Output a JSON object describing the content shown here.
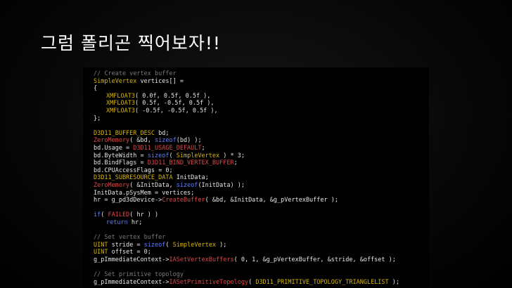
{
  "slide": {
    "title": "그럼 폴리곤 찍어보자!!"
  },
  "colors": {
    "background": "#000000",
    "title": "#ffffff",
    "code_text": "#e6e6e6",
    "comment": "#7a7a7a",
    "keyword": "#5f7dff",
    "type": "#d7b60c",
    "function": "#e04848"
  },
  "code": {
    "lines": [
      [
        [
          "c",
          "// Create vertex buffer"
        ]
      ],
      [
        [
          "ty",
          "SimpleVertex"
        ],
        [
          "tx",
          " vertices[] ="
        ]
      ],
      [
        [
          "tx",
          "{"
        ]
      ],
      [
        [
          "ty",
          "XMFLOAT3"
        ],
        [
          "tx",
          "( 0.0f, 0.5f, 0.5f ),"
        ]
      ],
      [
        [
          "ty",
          "XMFLOAT3"
        ],
        [
          "tx",
          "( 0.5f, -0.5f, 0.5f ),"
        ]
      ],
      [
        [
          "ty",
          "XMFLOAT3"
        ],
        [
          "tx",
          "( -0.5f, -0.5f, 0.5f ),"
        ]
      ],
      [
        [
          "tx",
          "};"
        ]
      ],
      [],
      [
        [
          "ty",
          "D3D11_BUFFER_DESC"
        ],
        [
          "tx",
          " bd;"
        ]
      ],
      [
        [
          "fn",
          "ZeroMemory"
        ],
        [
          "tx",
          "( &bd, "
        ],
        [
          "kw",
          "sizeof"
        ],
        [
          "tx",
          "(bd) );"
        ]
      ],
      [
        [
          "tx",
          "bd.Usage = "
        ],
        [
          "fn",
          "D3D11_USAGE_DEFAULT"
        ],
        [
          "tx",
          ";"
        ]
      ],
      [
        [
          "tx",
          "bd.ByteWidth = "
        ],
        [
          "kw",
          "sizeof"
        ],
        [
          "tx",
          "( "
        ],
        [
          "ty",
          "SimpleVertex"
        ],
        [
          "tx",
          " ) * 3;"
        ]
      ],
      [
        [
          "tx",
          "bd.BindFlags = "
        ],
        [
          "fn",
          "D3D11_BIND_VERTEX_BUFFER"
        ],
        [
          "tx",
          ";"
        ]
      ],
      [
        [
          "tx",
          "bd.CPUAccessFlags = 0;"
        ]
      ],
      [
        [
          "ty",
          "D3D11_SUBRESOURCE_DATA"
        ],
        [
          "tx",
          " InitData;"
        ]
      ],
      [
        [
          "fn",
          "ZeroMemory"
        ],
        [
          "tx",
          "( &InitData, "
        ],
        [
          "kw",
          "sizeof"
        ],
        [
          "tx",
          "(InitData) );"
        ]
      ],
      [
        [
          "tx",
          "InitData.pSysMem = vertices;"
        ]
      ],
      [
        [
          "tx",
          "hr = g_pd3dDevice->"
        ],
        [
          "fn",
          "CreateBuffer"
        ],
        [
          "tx",
          "( &bd, &InitData, &g_pVertexBuffer );"
        ]
      ],
      [],
      [
        [
          "kw",
          "if"
        ],
        [
          "tx",
          "( "
        ],
        [
          "fn",
          "FAILED"
        ],
        [
          "tx",
          "( hr ) )"
        ]
      ],
      [
        [
          "kw",
          "return"
        ],
        [
          "tx",
          " hr;"
        ]
      ],
      [],
      [
        [
          "c",
          "// Set vertex buffer"
        ]
      ],
      [
        [
          "ty",
          "UINT"
        ],
        [
          "tx",
          " stride = "
        ],
        [
          "kw",
          "sizeof"
        ],
        [
          "tx",
          "( "
        ],
        [
          "ty",
          "SimpleVertex"
        ],
        [
          "tx",
          " );"
        ]
      ],
      [
        [
          "ty",
          "UINT"
        ],
        [
          "tx",
          " offset = 0;"
        ]
      ],
      [
        [
          "tx",
          "g_pImmediateContext->"
        ],
        [
          "fn",
          "IASetVertexBuffers"
        ],
        [
          "tx",
          "( 0, 1, &g_pVertexBuffer, &stride, &offset );"
        ]
      ],
      [],
      [
        [
          "c",
          "// Set primitive topology"
        ]
      ],
      [
        [
          "tx",
          "g_pImmediateContext->"
        ],
        [
          "fn",
          "IASetPrimitiveTopology"
        ],
        [
          "tx",
          "( "
        ],
        [
          "ty",
          "D3D11_PRIMITIVE_TOPOLOGY_TRIANGLELIST"
        ],
        [
          "tx",
          " );"
        ]
      ]
    ]
  }
}
